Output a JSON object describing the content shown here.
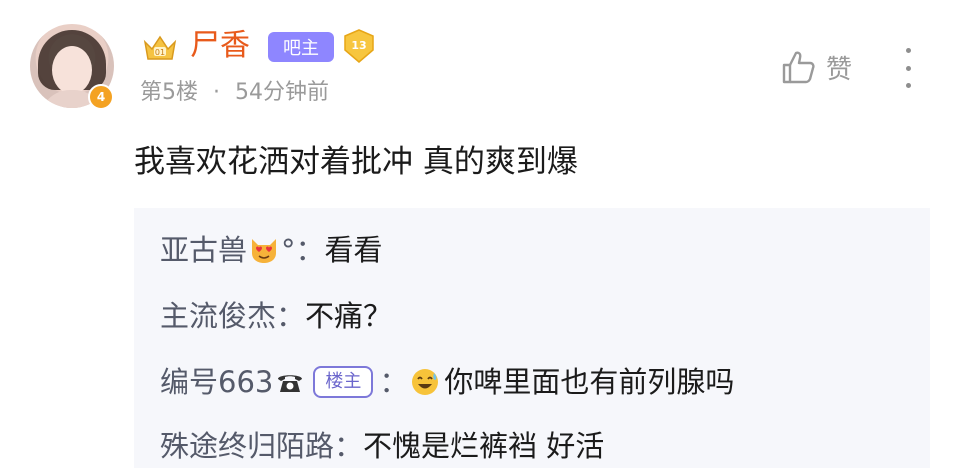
{
  "post": {
    "username": "尸香",
    "owner_badge": "吧主",
    "grade_level": "13",
    "avatar_level": "4",
    "floor": "第5楼",
    "separator": "·",
    "time": "54分钟前",
    "like_label": "赞",
    "content": "我喜欢花洒对着批冲 真的爽到爆"
  },
  "replies": [
    {
      "name": "亚古兽",
      "suffix": "°：",
      "text": "看看",
      "emoji_before_suffix": "heart-eyes-cat-icon"
    },
    {
      "name": "主流俊杰：",
      "text": "不痛？"
    },
    {
      "name": "编号663",
      "badge": "楼主",
      "colon": "：",
      "text": "你啤里面也有前列腺吗",
      "icon_after_name": "telephone-icon",
      "emoji_before_text": "sweat-smile-icon"
    },
    {
      "name": "殊途终归陌路：",
      "text": "不愧是烂裤裆 好活"
    }
  ],
  "colors": {
    "username": "#e85a1b",
    "owner_badge": "#8e86ff",
    "meta": "#9a9a9a",
    "reply_bg": "#f6f7fb"
  }
}
